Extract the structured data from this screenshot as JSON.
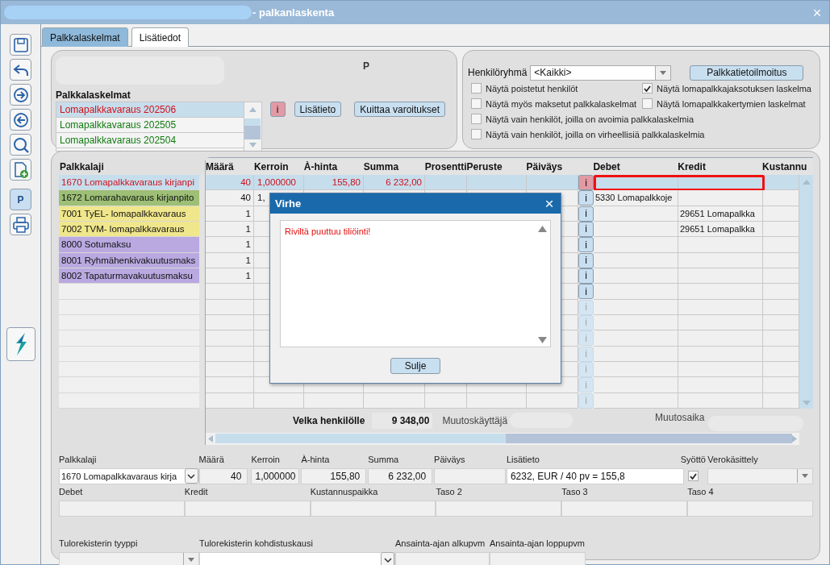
{
  "window": {
    "title": "- palkanlaskenta",
    "close": "×"
  },
  "toolbar": {
    "p_label": "P"
  },
  "tabs": [
    {
      "label": "Palkkalaskelmat",
      "selected": true
    },
    {
      "label": "Lisätiedot",
      "selected": false
    }
  ],
  "header_panel": {
    "code": "P",
    "list_title": "Palkkalaskelmat",
    "payslips": [
      {
        "label": "Lomapalkkavaraus 202506",
        "selected": true,
        "color": "#d0101a"
      },
      {
        "label": "Lomapalkkavaraus 202505",
        "selected": false,
        "color": "#107a10"
      },
      {
        "label": "Lomapalkkavaraus 202504",
        "selected": false,
        "color": "#107a10"
      }
    ],
    "info_button": "i",
    "buttons": [
      "Lisätieto",
      "Kuittaa varoitukset"
    ]
  },
  "filter_panel": {
    "group_label": "Henkilöryhmä",
    "group_value": "<Kaikki>",
    "report_button": "Palkkatietoilmoitus",
    "checkbox_rows": [
      [
        {
          "label": "Näytä poistetut henkilöt",
          "checked": false
        },
        {
          "label": "Näytä lomapalkkajaksotuksen laskelma",
          "checked": true
        }
      ],
      [
        {
          "label": "Näytä myös maksetut palkkalaskelmat",
          "checked": false
        },
        {
          "label": "Näytä lomapalkkakertymien laskelmat",
          "checked": false
        }
      ],
      [
        {
          "label": "Näytä vain henkilöt, joilla on avoimia palkkalaskelmia",
          "checked": false
        }
      ],
      [
        {
          "label": "Näytä vain henkilöt, joilla on virheellisiä palkkalaskelmia",
          "checked": false
        }
      ]
    ]
  },
  "grid": {
    "type_header": "Palkkalaji",
    "columns": [
      "Määrä",
      "Kerroin",
      "À-hinta",
      "Summa",
      "Prosentti",
      "Peruste",
      "Päiväys",
      "Debet",
      "Kredit",
      "Kustannu"
    ],
    "rows": [
      {
        "type": "1670 Lomapalkkavaraus kirjanpi",
        "selected": true,
        "error": true,
        "disabled": false,
        "info": "i",
        "cells": [
          "40",
          "1,000000",
          "155,80",
          "6 232,00",
          null,
          null,
          null,
          null,
          null,
          null
        ]
      },
      {
        "type": "1672 Lomarahavaraus kirjanpito",
        "color": "#9dbf76",
        "selected": false,
        "error": false,
        "disabled": false,
        "info": "i",
        "cells": [
          "40",
          "1,",
          null,
          null,
          null,
          null,
          null,
          "5330 Lomapalkkoje",
          null,
          null
        ]
      },
      {
        "type": "7001 TyEL- lomapalkkavaraus",
        "color": "#f0e68c",
        "selected": false,
        "error": false,
        "disabled": false,
        "info": "i",
        "cells": [
          "1",
          null,
          null,
          null,
          null,
          null,
          null,
          null,
          "29651 Lomapalkka",
          null
        ]
      },
      {
        "type": "7002 TVM- lomapalkkavaraus",
        "color": "#f0e68c",
        "selected": false,
        "error": false,
        "disabled": false,
        "info": "i",
        "cells": [
          "1",
          null,
          null,
          null,
          null,
          null,
          null,
          null,
          "29651 Lomapalkka",
          null
        ]
      },
      {
        "type": "8000 Sotumaksu",
        "color": "#b9a9e0",
        "selected": false,
        "error": false,
        "disabled": false,
        "info": "i",
        "cells": [
          "1",
          null,
          null,
          null,
          null,
          null,
          null,
          null,
          null,
          null
        ]
      },
      {
        "type": "8001 Ryhmähenkivakuutusmaks",
        "color": "#b9a9e0",
        "selected": false,
        "error": false,
        "disabled": false,
        "info": "i",
        "cells": [
          "1",
          null,
          null,
          null,
          null,
          null,
          null,
          null,
          null,
          null
        ]
      },
      {
        "type": "8002 Tapaturmavakuutusmaksu",
        "color": "#b9a9e0",
        "selected": false,
        "error": false,
        "disabled": false,
        "info": "i",
        "cells": [
          "1",
          null,
          null,
          null,
          null,
          null,
          null,
          null,
          null,
          null
        ]
      },
      {
        "selected": false,
        "error": false,
        "disabled": false,
        "info": "i"
      },
      {
        "selected": false,
        "error": false,
        "disabled": true,
        "info": "i"
      },
      {
        "selected": false,
        "error": false,
        "disabled": true,
        "info": "i"
      },
      {
        "selected": false,
        "error": false,
        "disabled": true,
        "info": "i"
      },
      {
        "selected": false,
        "error": false,
        "disabled": true,
        "info": "i"
      },
      {
        "selected": false,
        "error": false,
        "disabled": true,
        "info": "i"
      },
      {
        "selected": false,
        "error": false,
        "disabled": true,
        "info": "i"
      },
      {
        "selected": false,
        "error": false,
        "disabled": true,
        "info": "i"
      }
    ],
    "debt_label": "Velka henkilölle",
    "debt_value": "9 348,00",
    "changed_by_label": "Muutoskäyttäjä",
    "changed_at_label": "Muutosaika"
  },
  "form_rows": [
    [
      {
        "label": "Palkkalaji",
        "kind": "combo",
        "value": "1670 Lomapalkkavaraus kirja"
      },
      {
        "label": "Määrä",
        "kind": "number",
        "value": "40"
      },
      {
        "label": "Kerroin",
        "kind": "number",
        "value": "1,000000"
      },
      {
        "label": "À-hinta",
        "kind": "number",
        "value": "155,80"
      },
      {
        "label": "Summa",
        "kind": "number",
        "value": "6 232,00"
      },
      {
        "label": "Päiväys",
        "kind": "text"
      },
      {
        "label": "Lisätieto",
        "kind": "text",
        "value": "6232, EUR / 40 pv = 155,8"
      },
      {
        "label": "Syöttö",
        "kind": "checkbox",
        "checked": true
      },
      {
        "label": "Verokäsittely",
        "kind": "select"
      }
    ],
    [
      {
        "label": "Debet",
        "kind": "text"
      },
      {
        "label": "Kredit",
        "kind": "text"
      },
      {
        "label": "Kustannuspaikka",
        "kind": "text"
      },
      {
        "label": "Taso 2",
        "kind": "text"
      },
      {
        "label": "Taso 3",
        "kind": "text"
      },
      {
        "label": "Taso 4",
        "kind": "text"
      }
    ],
    [
      {
        "label": "Tulorekisterin tyyppi",
        "kind": "select"
      },
      {
        "label": "Tulorekisterin kohdistuskausi",
        "kind": "combo"
      },
      {
        "label": "Ansainta-ajan alkupvm",
        "kind": "text"
      },
      {
        "label": "Ansainta-ajan loppupvm",
        "kind": "text"
      }
    ]
  ],
  "dialog": {
    "title": "Virhe",
    "message": "Riviltä puuttuu tiliöinti!",
    "close": "×",
    "button": "Sulje"
  }
}
